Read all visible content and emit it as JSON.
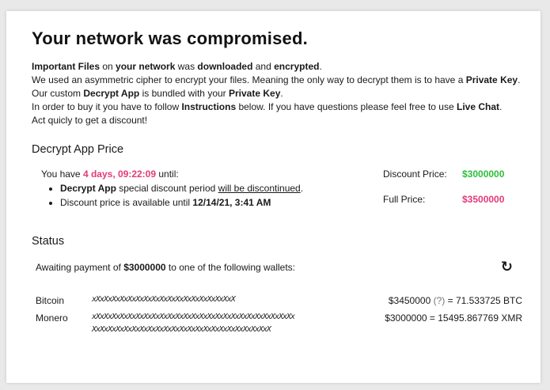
{
  "title": "Your network was compromised.",
  "intro": {
    "l1_a": "Important Files",
    "l1_b": " on ",
    "l1_c": "your network",
    "l1_d": " was ",
    "l1_e": "downloaded",
    "l1_f": " and ",
    "l1_g": "encrypted",
    "l1_h": ".",
    "l2_a": "We used an asymmetric cipher to encrypt your files. Meaning the only way to decrypt them is to have a ",
    "l2_b": "Private Key",
    "l2_c": ".",
    "l3_a": "Our custom ",
    "l3_b": "Decrypt App",
    "l3_c": " is bundled with your ",
    "l3_d": "Private Key",
    "l3_e": ".",
    "l4_a": "In order to buy it you have to follow ",
    "l4_b": "Instructions",
    "l4_c": " below. If you have questions please feel free to use ",
    "l4_d": "Live Chat",
    "l4_e": ".",
    "l5": "Act quicly to get a discount!"
  },
  "price_section": {
    "title": "Decrypt App Price",
    "timer_prefix": "You have ",
    "timer": "4 days, 09:22:09",
    "timer_suffix": " until:",
    "bullet1_bold": "Decrypt App",
    "bullet1_mid": " special discount period ",
    "bullet1_underline": "will be discontinued",
    "bullet1_end": ".",
    "bullet2_a": "Discount price is available until ",
    "bullet2_b": "12/14/21, 3:41 AM",
    "discount_label": "Discount Price:",
    "discount_value": "$3000000",
    "full_label": "Full Price:",
    "full_value": "$3500000"
  },
  "status": {
    "title": "Status",
    "await_a": "Awaiting payment of ",
    "await_b": "$3000000",
    "await_c": " to one of the following wallets:",
    "refresh_icon": "↻"
  },
  "wallets": [
    {
      "name": "Bitcoin",
      "address": "xXxXxXxXxXxXxXxXxXxXxXxXxXxXxXxXxXxX",
      "amount_a": "$3450000 ",
      "amount_q": "(?)",
      "amount_b": " = 71.533725 BTC"
    },
    {
      "name": "Monero",
      "address": "xXxXxXxXxXxXxXxXxXxXxXxXxXxXxXxXxXxXxXxXxXxXxXxXxXxXxXxXxXxXxXxXxXxXxXxXxXxXxXxXxXxXxXxXxXxXxXxX",
      "amount_a": "$3000000 = 15495.867769 XMR",
      "amount_q": "",
      "amount_b": ""
    }
  ],
  "colors": {
    "timer": "#e43a79",
    "discount": "#2bbf3a",
    "full": "#e43a79"
  }
}
